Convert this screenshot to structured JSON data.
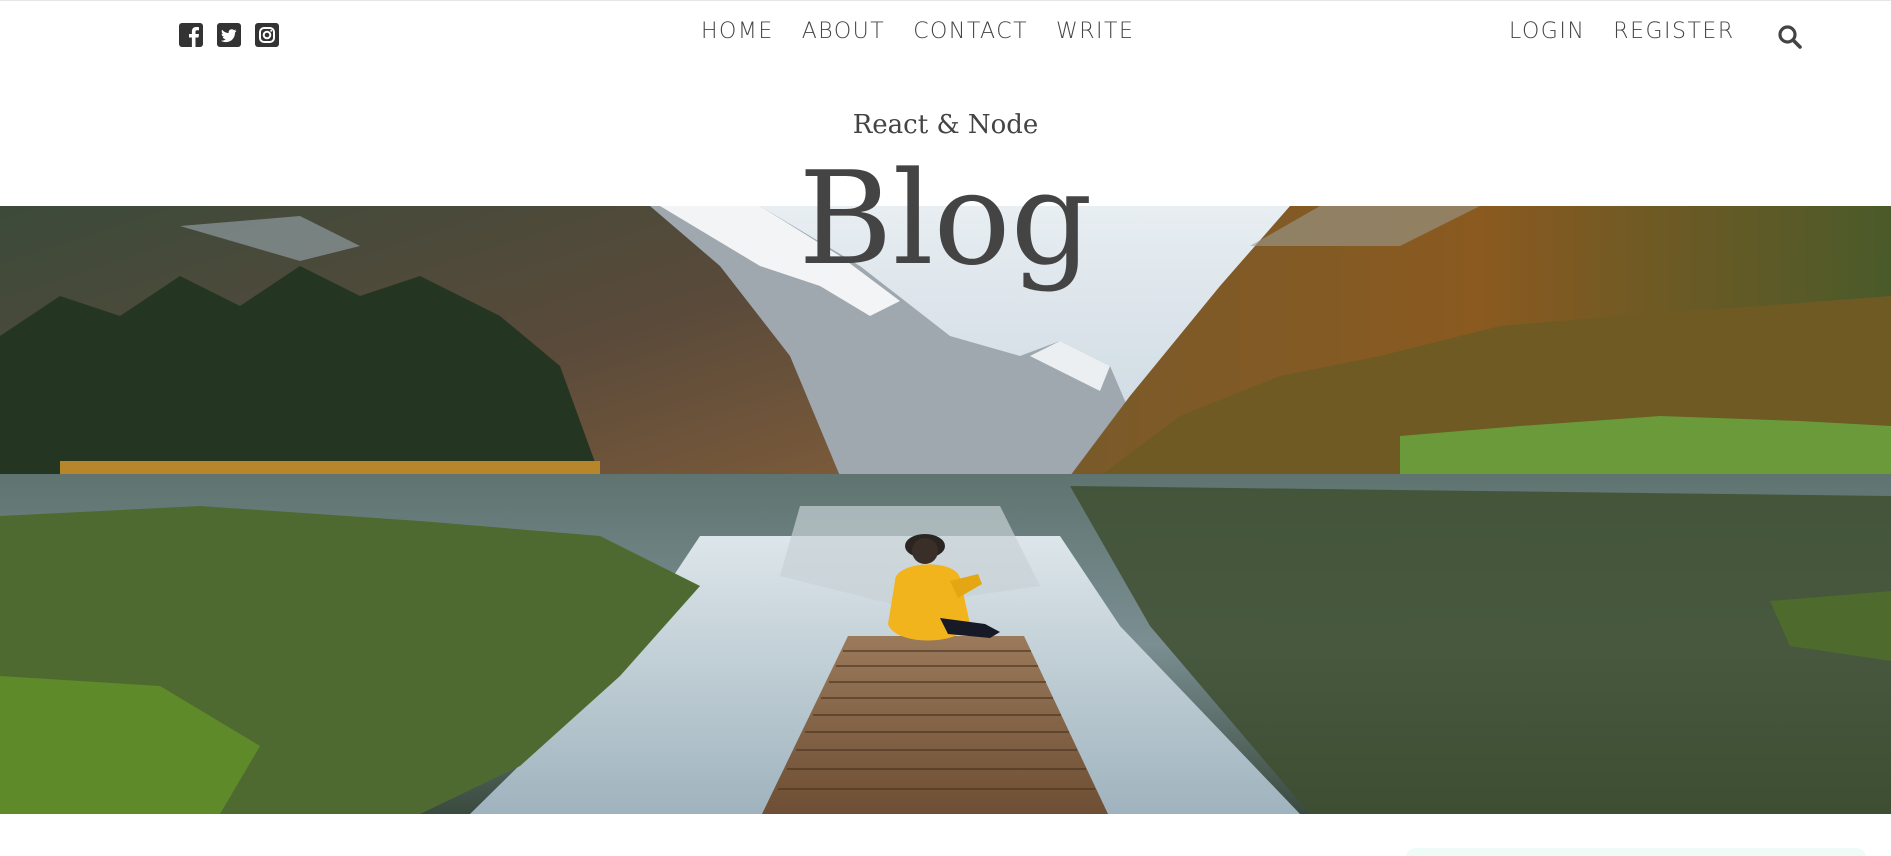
{
  "header": {
    "social": [
      {
        "icon": "facebook-square-icon"
      },
      {
        "icon": "twitter-square-icon"
      },
      {
        "icon": "instagram-square-icon"
      }
    ],
    "nav": [
      "HOME",
      "ABOUT",
      "CONTACT",
      "WRITE"
    ],
    "auth": [
      "LOGIN",
      "REGISTER"
    ],
    "search_icon": "search-icon"
  },
  "hero": {
    "subtitle": "React & Node",
    "title": "Blog",
    "image_subject": "mountain lake with wooden pier and person in yellow jacket"
  },
  "colors": {
    "text": "#444444",
    "background": "#ffffff",
    "accent_yellow": "#f2b41d",
    "sidebar_tint": "#eefbf7"
  }
}
